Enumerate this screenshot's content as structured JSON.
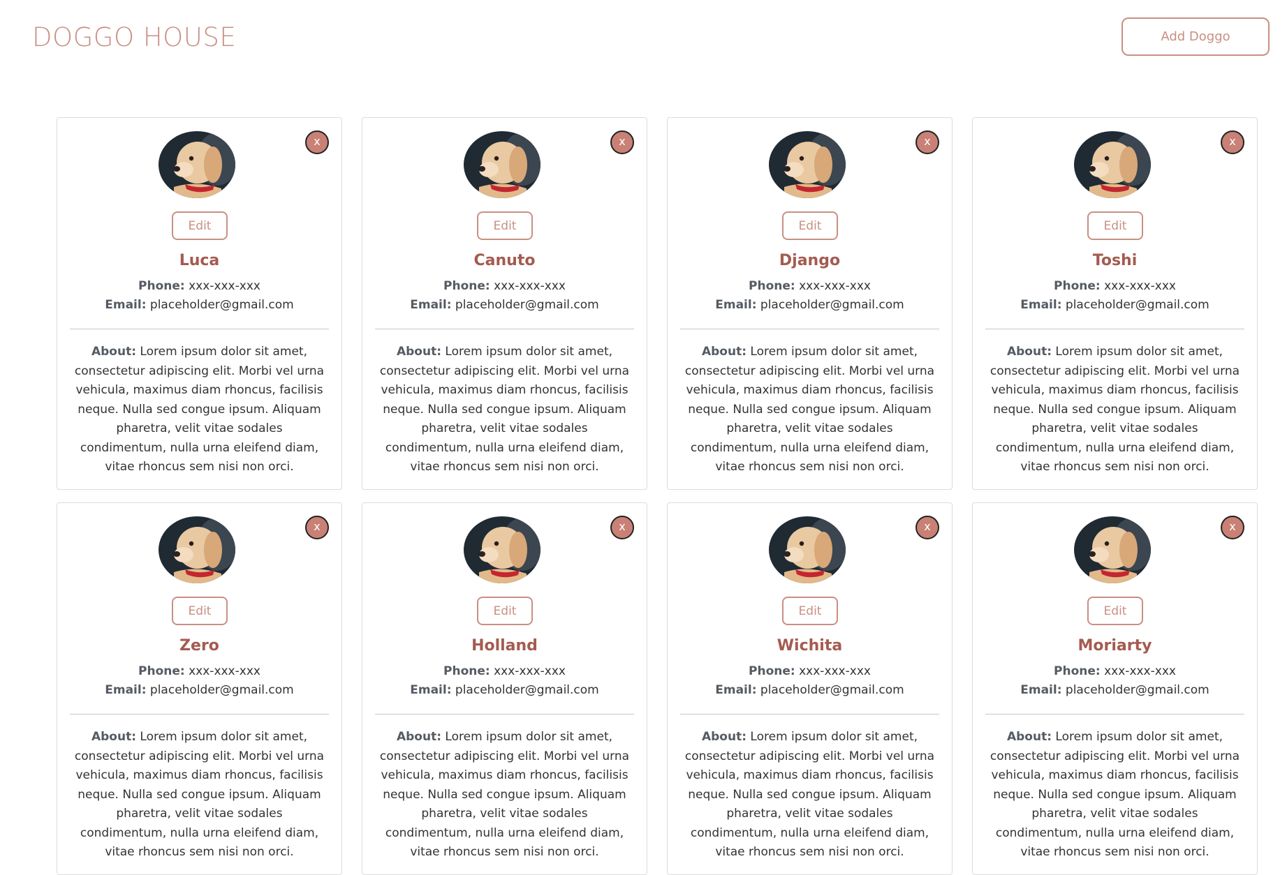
{
  "header": {
    "title": "DOGGO HOUSE",
    "add_label": "Add Doggo"
  },
  "card_labels": {
    "close": "x",
    "edit": "Edit",
    "phone_label": "Phone:",
    "email_label": "Email:",
    "about_label": "About:"
  },
  "dogs": [
    {
      "name": "Luca",
      "phone": "xxx-xxx-xxx",
      "email": "placeholder@gmail.com",
      "about": "Lorem ipsum dolor sit amet, consectetur adipiscing elit. Morbi vel urna vehicula, maximus diam rhoncus, facilisis neque. Nulla sed congue ipsum. Aliquam pharetra, velit vitae sodales condimentum, nulla urna eleifend diam, vitae rhoncus sem nisi non orci."
    },
    {
      "name": "Canuto",
      "phone": "xxx-xxx-xxx",
      "email": "placeholder@gmail.com",
      "about": "Lorem ipsum dolor sit amet, consectetur adipiscing elit. Morbi vel urna vehicula, maximus diam rhoncus, facilisis neque. Nulla sed congue ipsum. Aliquam pharetra, velit vitae sodales condimentum, nulla urna eleifend diam, vitae rhoncus sem nisi non orci."
    },
    {
      "name": "Django",
      "phone": "xxx-xxx-xxx",
      "email": "placeholder@gmail.com",
      "about": "Lorem ipsum dolor sit amet, consectetur adipiscing elit. Morbi vel urna vehicula, maximus diam rhoncus, facilisis neque. Nulla sed congue ipsum. Aliquam pharetra, velit vitae sodales condimentum, nulla urna eleifend diam, vitae rhoncus sem nisi non orci."
    },
    {
      "name": "Toshi",
      "phone": "xxx-xxx-xxx",
      "email": "placeholder@gmail.com",
      "about": "Lorem ipsum dolor sit amet, consectetur adipiscing elit. Morbi vel urna vehicula, maximus diam rhoncus, facilisis neque. Nulla sed congue ipsum. Aliquam pharetra, velit vitae sodales condimentum, nulla urna eleifend diam, vitae rhoncus sem nisi non orci."
    },
    {
      "name": "Zero",
      "phone": "xxx-xxx-xxx",
      "email": "placeholder@gmail.com",
      "about": "Lorem ipsum dolor sit amet, consectetur adipiscing elit. Morbi vel urna vehicula, maximus diam rhoncus, facilisis neque. Nulla sed congue ipsum. Aliquam pharetra, velit vitae sodales condimentum, nulla urna eleifend diam, vitae rhoncus sem nisi non orci."
    },
    {
      "name": "Holland",
      "phone": "xxx-xxx-xxx",
      "email": "placeholder@gmail.com",
      "about": "Lorem ipsum dolor sit amet, consectetur adipiscing elit. Morbi vel urna vehicula, maximus diam rhoncus, facilisis neque. Nulla sed congue ipsum. Aliquam pharetra, velit vitae sodales condimentum, nulla urna eleifend diam, vitae rhoncus sem nisi non orci."
    },
    {
      "name": "Wichita",
      "phone": "xxx-xxx-xxx",
      "email": "placeholder@gmail.com",
      "about": "Lorem ipsum dolor sit amet, consectetur adipiscing elit. Morbi vel urna vehicula, maximus diam rhoncus, facilisis neque. Nulla sed congue ipsum. Aliquam pharetra, velit vitae sodales condimentum, nulla urna eleifend diam, vitae rhoncus sem nisi non orci."
    },
    {
      "name": "Moriarty",
      "phone": "xxx-xxx-xxx",
      "email": "placeholder@gmail.com",
      "about": "Lorem ipsum dolor sit amet, consectetur adipiscing elit. Morbi vel urna vehicula, maximus diam rhoncus, facilisis neque. Nulla sed congue ipsum. Aliquam pharetra, velit vitae sodales condimentum, nulla urna eleifend diam, vitae rhoncus sem nisi non orci."
    }
  ]
}
